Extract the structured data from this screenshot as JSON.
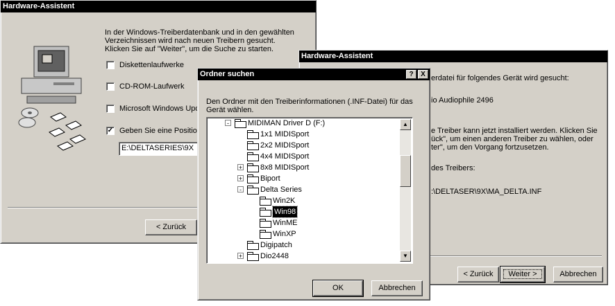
{
  "wizard1": {
    "title": "Hardware-Assistent",
    "intro_lines": [
      "In der Windows-Treiberdatenbank und in den gewählten",
      "Verzeichnissen wird nach neuen Treibern gesucht.",
      "Klicken Sie auf \"Weiter\", um die Suche zu starten."
    ],
    "options": [
      {
        "label": "Diskettenlaufwerke",
        "checked": false
      },
      {
        "label": "CD-ROM-Laufwerk",
        "checked": false
      },
      {
        "label": "Microsoft Windows Upd",
        "checked": false
      },
      {
        "label": "Geben Sie eine Position",
        "checked": true
      }
    ],
    "path_value": "E:\\DELTASERIES\\9X",
    "back_button": "< Zurück"
  },
  "wizard2": {
    "title": "Hardware-Assistent",
    "lines": [
      "erdatei für folgendes Gerät wird gesucht:",
      "io Audiophile 2496",
      "e Treiber kann jetzt installiert werden. Klicken Sie",
      "ück\", um einen anderen Treiber zu wählen, oder",
      "ter\", um den Vorgang fortzusetzen.",
      "des Treibers:",
      ":\\DELTASER\\9X\\MA_DELTA.INF"
    ],
    "back_button": "< Zurück",
    "next_button": "Weiter >",
    "cancel_button": "Abbrechen"
  },
  "dialog": {
    "title": "Ordner suchen",
    "help_button": "?",
    "close_button": "X",
    "description_lines": [
      "Den Ordner mit den Treiberinformationen (.INF-Datei) für das",
      "Gerät wählen."
    ],
    "tree": [
      {
        "label": "MIDIMAN Driver D (F:)",
        "level": 0,
        "expander": "-",
        "icon": "cd-drive-icon"
      },
      {
        "label": "1x1 MIDISport",
        "level": 1,
        "expander": "",
        "icon": "folder-icon"
      },
      {
        "label": "2x2 MIDISport",
        "level": 1,
        "expander": "",
        "icon": "folder-icon"
      },
      {
        "label": "4x4 MIDISport",
        "level": 1,
        "expander": "",
        "icon": "folder-icon"
      },
      {
        "label": "8x8 MIDISport",
        "level": 1,
        "expander": "+",
        "icon": "folder-icon"
      },
      {
        "label": "Biport",
        "level": 1,
        "expander": "+",
        "icon": "folder-icon"
      },
      {
        "label": "Delta Series",
        "level": 1,
        "expander": "-",
        "icon": "folder-icon"
      },
      {
        "label": "Win2K",
        "level": 2,
        "expander": "",
        "icon": "folder-icon"
      },
      {
        "label": "Win98",
        "level": 2,
        "expander": "",
        "icon": "folder-open-icon",
        "selected": true
      },
      {
        "label": "WinME",
        "level": 2,
        "expander": "",
        "icon": "folder-icon"
      },
      {
        "label": "WinXP",
        "level": 2,
        "expander": "",
        "icon": "folder-icon"
      },
      {
        "label": "Digipatch",
        "level": 1,
        "expander": "",
        "icon": "folder-icon"
      },
      {
        "label": "Dio2448",
        "level": 1,
        "expander": "+",
        "icon": "folder-icon"
      }
    ],
    "ok_button": "OK",
    "cancel_button": "Abbrechen"
  }
}
